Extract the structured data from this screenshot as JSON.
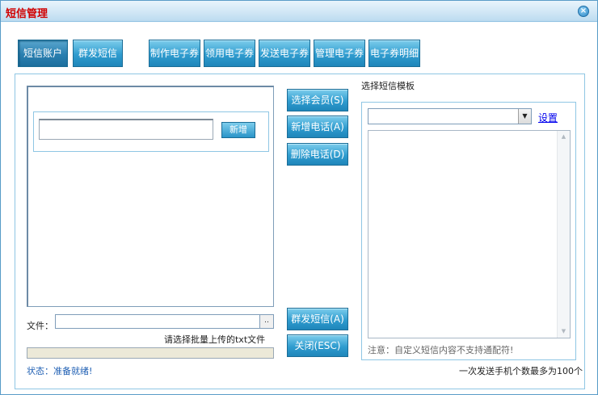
{
  "window": {
    "title": "短信管理",
    "close_glyph": "×"
  },
  "tabs": [
    {
      "label": "短信账户",
      "active": true
    },
    {
      "label": "群发短信",
      "active": false
    },
    {
      "label": "制作电子券",
      "active": false
    },
    {
      "label": "领用电子券",
      "active": false
    },
    {
      "label": "发送电子券",
      "active": false
    },
    {
      "label": "管理电子券",
      "active": false
    },
    {
      "label": "电子券明细",
      "active": false
    }
  ],
  "phone_group": {
    "input_value": "",
    "add_label": "新增"
  },
  "actions": {
    "select_member": "选择会员(S)",
    "add_phone": "新增电话(A)",
    "delete_phone": "删除电话(D)",
    "mass_send": "群发短信(A)",
    "close": "关闭(ESC)"
  },
  "file": {
    "label": "文件：",
    "value": "",
    "browse": "..",
    "hint": "请选择批量上传的txt文件"
  },
  "status": "状态：准备就绪!",
  "template": {
    "label": "选择短信模板",
    "selected": "",
    "settings_link": "设置",
    "content": "",
    "notice": "注意：自定义短信内容不支持通配符!"
  },
  "limit_text": "一次发送手机个数最多为100个",
  "icons": {
    "dropdown": "chevron-down-icon",
    "scroll_up": "arrow-up-icon",
    "scroll_down": "arrow-down-icon"
  },
  "colors": {
    "title": "#d10000",
    "button": "#2f9ccf",
    "status": "#1f5fb3",
    "link": "#0000ee"
  }
}
